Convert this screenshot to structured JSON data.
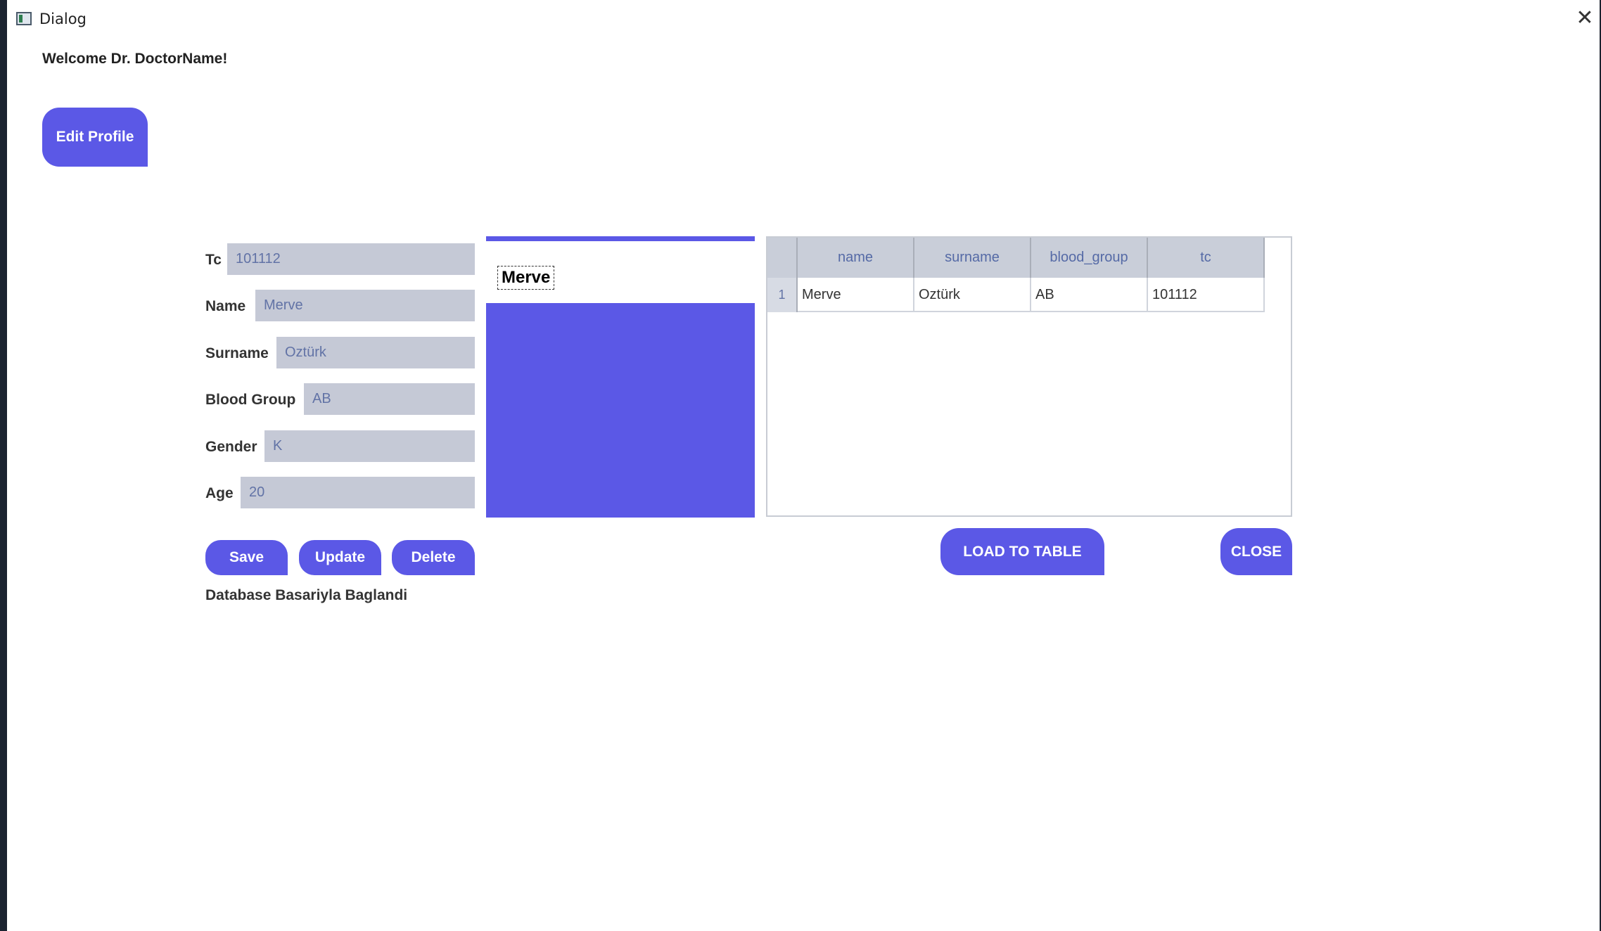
{
  "window": {
    "title": "Dialog"
  },
  "welcome": "Welcome Dr. DoctorName!",
  "edit_profile_label": "Edit Profile",
  "form": {
    "fields": [
      {
        "label": "Tc",
        "value": "101112"
      },
      {
        "label": "Name",
        "value": "Merve"
      },
      {
        "label": "Surname",
        "value": "Oztürk"
      },
      {
        "label": "Blood Group",
        "value": "AB"
      },
      {
        "label": "Gender",
        "value": "K"
      },
      {
        "label": "Age",
        "value": "20"
      }
    ],
    "buttons": {
      "save": "Save",
      "update": "Update",
      "delete": "Delete"
    },
    "status": "Database Basariyla Baglandi"
  },
  "panel": {
    "name_label": "Merve"
  },
  "table": {
    "columns": [
      "name",
      "surname",
      "blood_group",
      "tc"
    ],
    "rows": [
      {
        "index": "1",
        "cells": [
          "Merve",
          "Oztürk",
          "AB",
          "101112"
        ]
      }
    ]
  },
  "actions": {
    "load_label": "LOAD TO TABLE",
    "close_label": "CLOSE"
  },
  "colors": {
    "accent": "#5b58e6",
    "input_bg": "#c5c9d6",
    "header_bg": "#c9ced9"
  }
}
